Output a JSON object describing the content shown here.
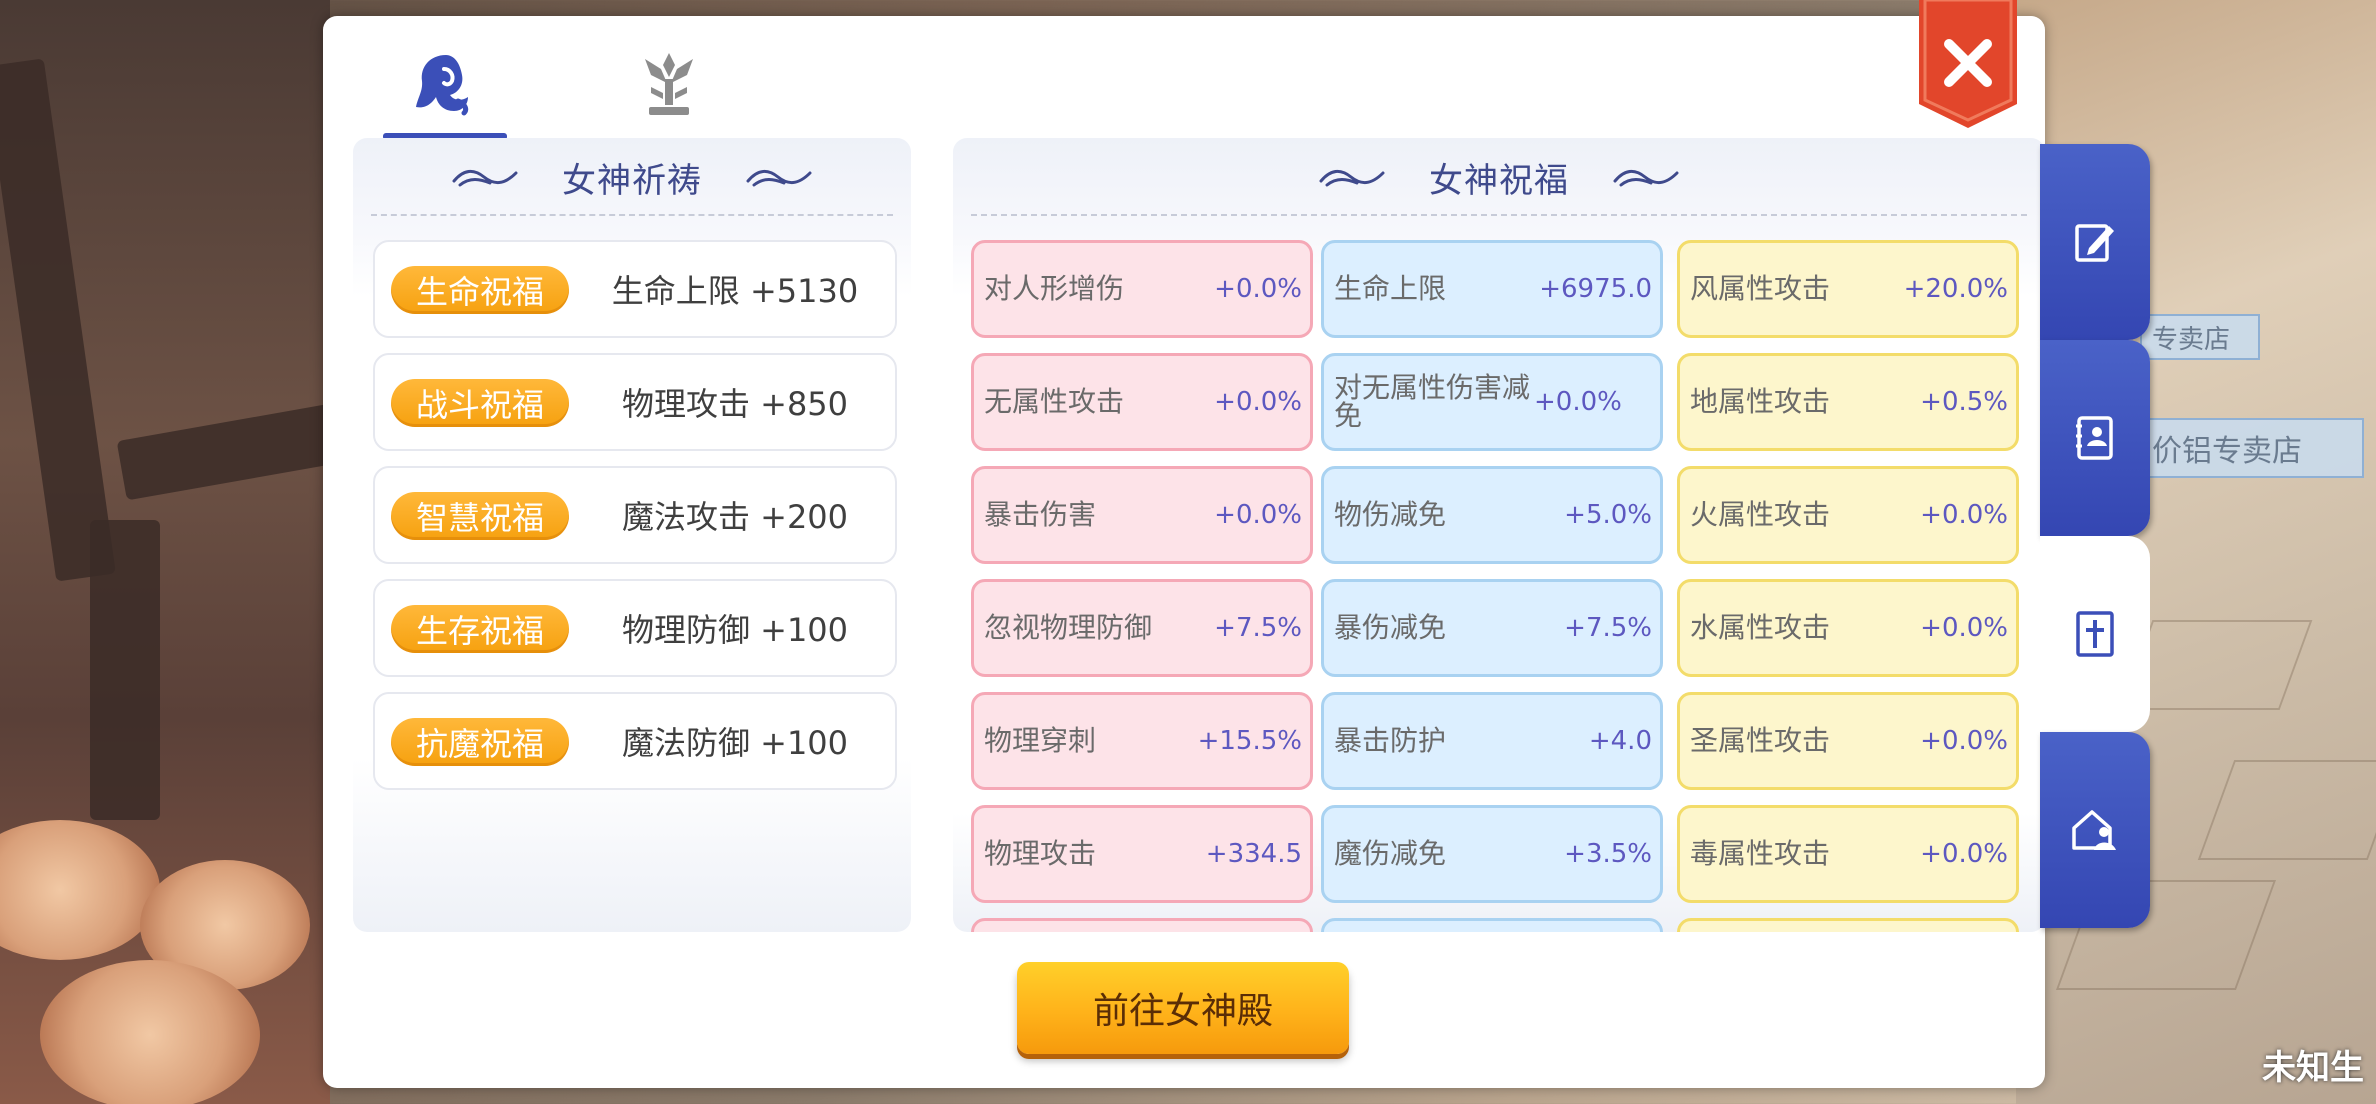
{
  "top_tabs": [
    {
      "name": "goddess-icon",
      "active": true
    },
    {
      "name": "emblem-icon",
      "active": false
    }
  ],
  "prayer": {
    "title": "女神祈祷",
    "rows": [
      {
        "badge": "生命祝福",
        "value": "生命上限 +5130"
      },
      {
        "badge": "战斗祝福",
        "value": "物理攻击 +850"
      },
      {
        "badge": "智慧祝福",
        "value": "魔法攻击 +200"
      },
      {
        "badge": "生存祝福",
        "value": "物理防御 +100"
      },
      {
        "badge": "抗魔祝福",
        "value": "魔法防御 +100"
      }
    ]
  },
  "blessing": {
    "title": "女神祝福",
    "columns": [
      {
        "color": "pink",
        "items": [
          {
            "name": "对人形增伤",
            "value": "+0.0%"
          },
          {
            "name": "无属性攻击",
            "value": "+0.0%"
          },
          {
            "name": "暴击伤害",
            "value": "+0.0%"
          },
          {
            "name": "忽视物理防御",
            "value": "+7.5%"
          },
          {
            "name": "物理穿刺",
            "value": "+15.5%"
          },
          {
            "name": "物理攻击",
            "value": "+334.5"
          }
        ]
      },
      {
        "color": "blue",
        "items": [
          {
            "name": "生命上限",
            "value": "+6975.0"
          },
          {
            "name": "对无属性伤害减免",
            "value": "+0.0%"
          },
          {
            "name": "物伤减免",
            "value": "+5.0%"
          },
          {
            "name": "暴伤减免",
            "value": "+7.5%"
          },
          {
            "name": "暴击防护",
            "value": "+4.0"
          },
          {
            "name": "魔伤减免",
            "value": "+3.5%"
          }
        ]
      },
      {
        "color": "yellow",
        "items": [
          {
            "name": "风属性攻击",
            "value": "+20.0%"
          },
          {
            "name": "地属性攻击",
            "value": "+0.5%"
          },
          {
            "name": "火属性攻击",
            "value": "+0.0%"
          },
          {
            "name": "水属性攻击",
            "value": "+0.0%"
          },
          {
            "name": "圣属性攻击",
            "value": "+0.0%"
          },
          {
            "name": "毒属性攻击",
            "value": "+0.0%"
          }
        ]
      }
    ]
  },
  "go_button": "前往女神殿",
  "side_tabs": [
    {
      "name": "edit-icon",
      "active": false
    },
    {
      "name": "contacts-book-icon",
      "active": false
    },
    {
      "name": "cross-icon",
      "active": true
    },
    {
      "name": "house-person-icon",
      "active": false
    }
  ],
  "background": {
    "sign_1": "专卖店",
    "sign_2": "价铝专卖店",
    "corner_text": "未知生"
  },
  "colors": {
    "accent_blue": "#3b4fb8",
    "button_orange": "#ffb21a",
    "close_red": "#e2462b",
    "value_purple": "#5d58c0"
  }
}
